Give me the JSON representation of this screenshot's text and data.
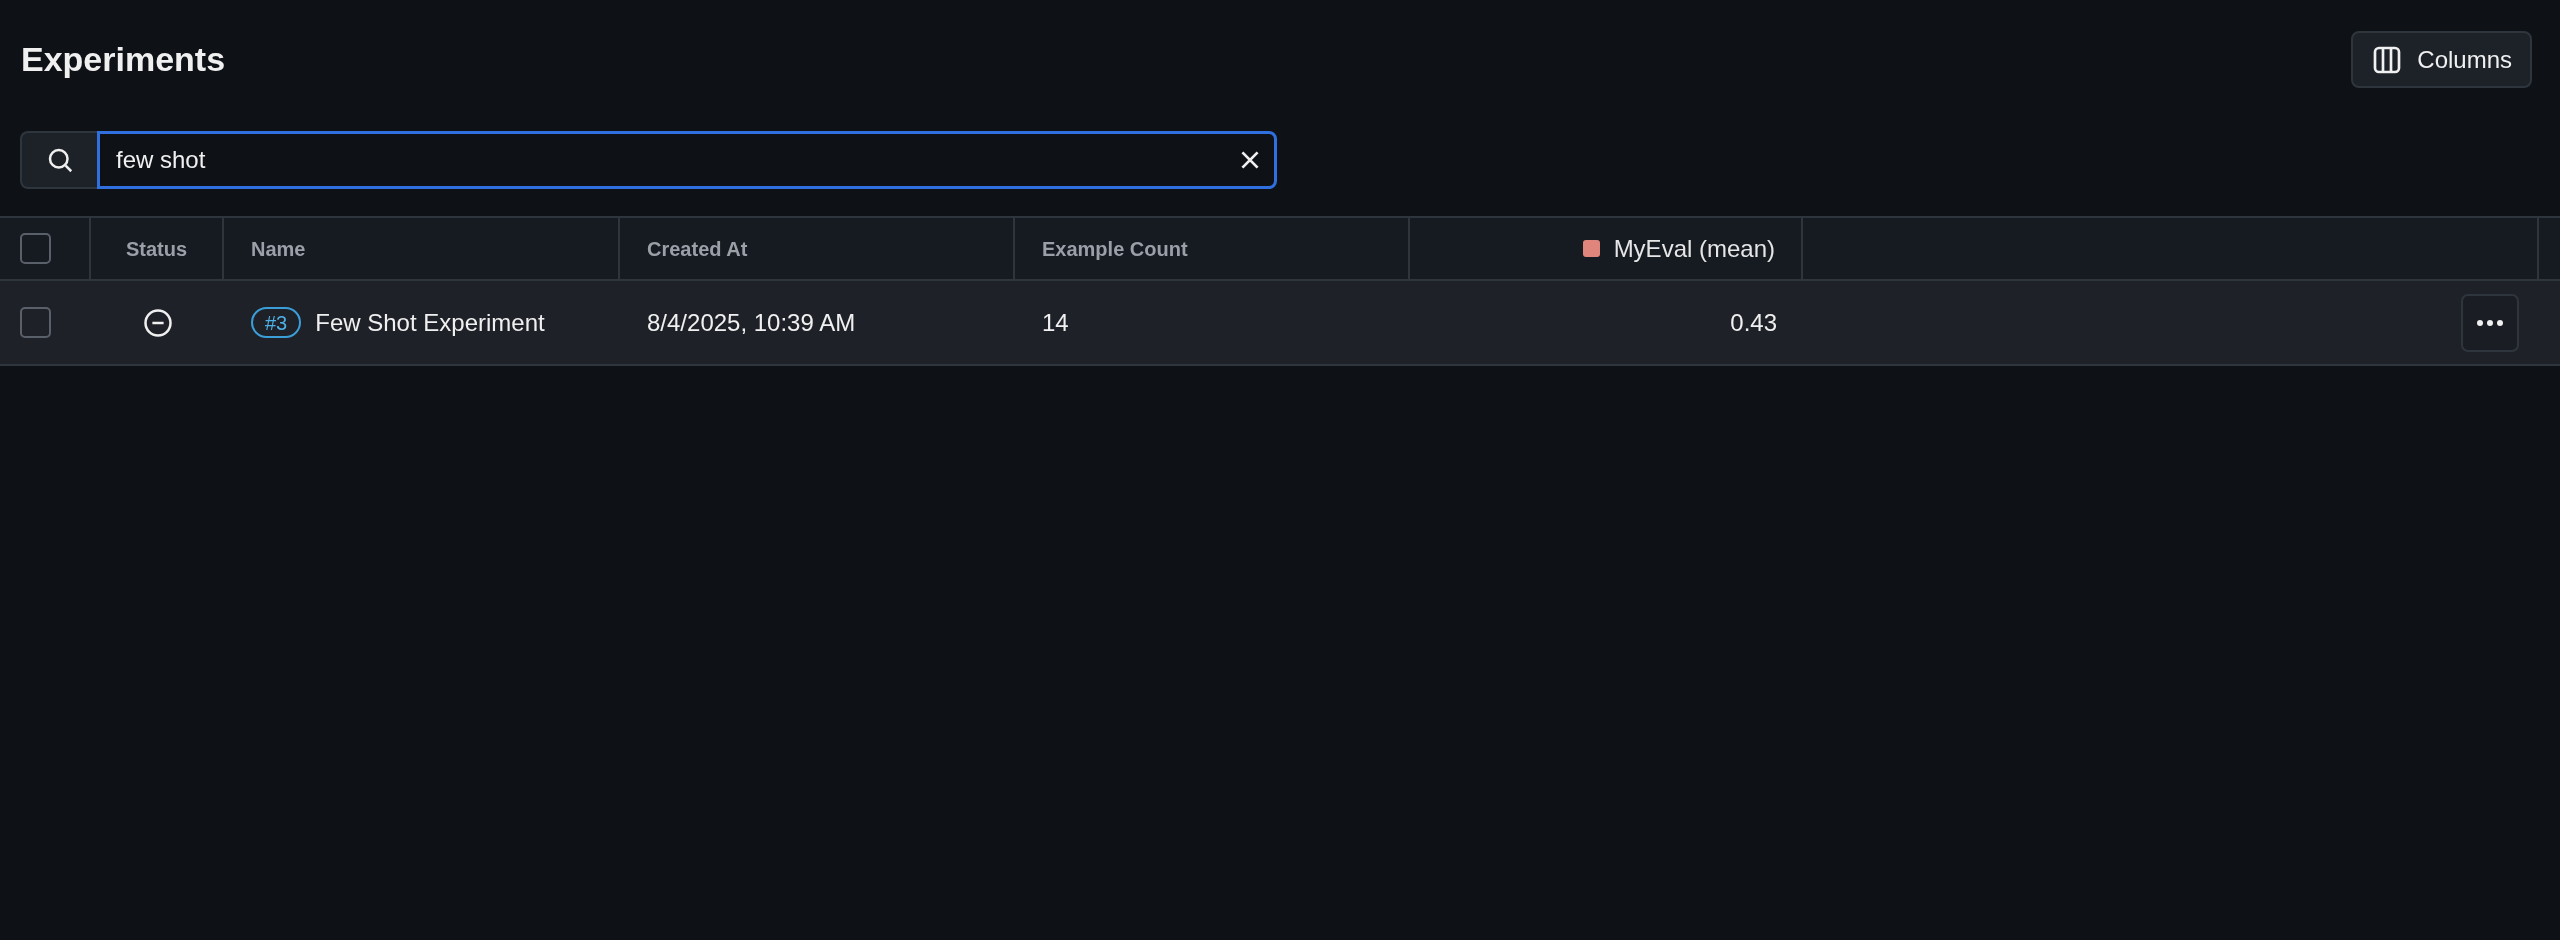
{
  "page": {
    "title": "Experiments"
  },
  "columns_button": {
    "label": "Columns"
  },
  "search": {
    "value": "few shot",
    "focused": true
  },
  "table": {
    "all_selected": false,
    "columns": [
      {
        "kind": "status",
        "label": "Status"
      },
      {
        "kind": "name",
        "label": "Name"
      },
      {
        "kind": "text",
        "label": "Created At"
      },
      {
        "kind": "text",
        "label": "Example Count"
      },
      {
        "kind": "eval",
        "label": "MyEval (mean)",
        "color": "#e0857b"
      }
    ],
    "rows": [
      {
        "selected": false,
        "status": {
          "kind": "cancelled"
        },
        "badge": "#3",
        "name": "Few Shot Experiment",
        "created_at": "8/4/2025, 10:39 AM",
        "example_count": "14",
        "eval": "0.43"
      }
    ]
  }
}
